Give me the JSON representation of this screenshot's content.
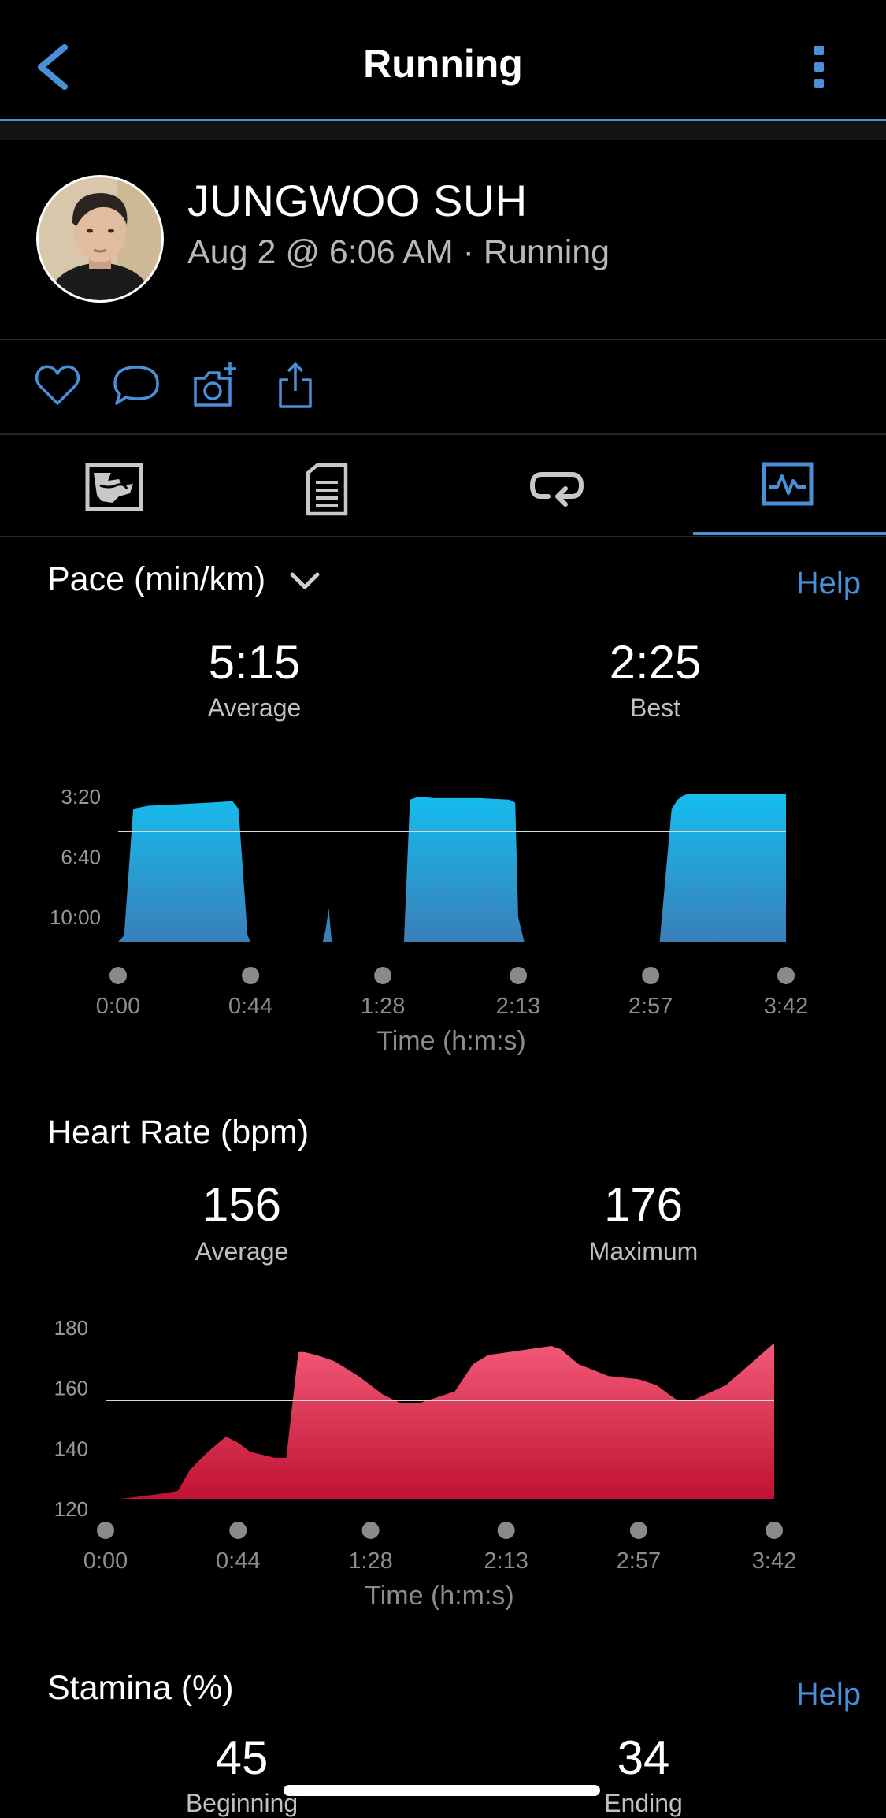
{
  "nav": {
    "title": "Running",
    "back_icon": "chevron-left-icon",
    "more_icon": "more-vertical-icon",
    "accent": "#4a90d9"
  },
  "profile": {
    "name": "JUNGWOO SUH",
    "meta": "Aug 2 @ 6:06 AM · Running"
  },
  "actions": [
    "heart-icon",
    "comment-icon",
    "add-photo-icon",
    "share-icon"
  ],
  "tabs": [
    "map-icon",
    "details-icon",
    "laps-icon",
    "charts-icon"
  ],
  "active_tab": "charts-icon",
  "pace": {
    "title": "Pace (min/km)",
    "help": "Help",
    "avg_value": "5:15",
    "avg_label": "Average",
    "best_value": "2:25",
    "best_label": "Best"
  },
  "heart": {
    "title": "Heart Rate (bpm)",
    "avg_value": "156",
    "avg_label": "Average",
    "max_value": "176",
    "max_label": "Maximum"
  },
  "stamina": {
    "title": "Stamina (%)",
    "help": "Help",
    "begin_value": "45",
    "begin_label": "Beginning",
    "end_value": "34",
    "end_label": "Ending"
  },
  "chart_data": [
    {
      "type": "area",
      "title": "Pace (min/km)",
      "xlabel": "Time (h:m:s)",
      "x_ticks": [
        "0:00",
        "0:44",
        "1:28",
        "2:13",
        "2:57",
        "3:42"
      ],
      "y_ticks": [
        "3:20",
        "6:40",
        "10:00"
      ],
      "y_axis_reversed": true,
      "reference_line": "5:15",
      "color": "#1cb8ea",
      "x": [
        "0:00",
        "0:02",
        "0:05",
        "0:10",
        "0:20",
        "0:30",
        "0:38",
        "0:40",
        "0:43",
        "0:44",
        "1:00",
        "1:08",
        "1:09",
        "1:10",
        "1:11",
        "1:28",
        "1:35",
        "1:37",
        "1:40",
        "1:45",
        "2:00",
        "2:10",
        "2:12",
        "2:13",
        "2:15",
        "2:30",
        "2:57",
        "3:00",
        "3:04",
        "3:06",
        "3:08",
        "3:10",
        "3:15",
        "3:30",
        "3:42"
      ],
      "y": [
        "11:40",
        "11:00",
        "4:00",
        "3:50",
        "3:45",
        "3:40",
        "3:35",
        "4:00",
        "11:00",
        "12:00",
        "12:00",
        "12:00",
        "10:40",
        "9:30",
        "12:00",
        "12:00",
        "12:00",
        "3:30",
        "3:20",
        "3:25",
        "3:25",
        "3:30",
        "3:40",
        "10:00",
        "12:00",
        "12:00",
        "12:00",
        "12:00",
        "4:00",
        "3:30",
        "3:15",
        "3:10",
        "3:10",
        "3:10",
        "3:10"
      ]
    },
    {
      "type": "area",
      "title": "Heart Rate (bpm)",
      "xlabel": "Time (h:m:s)",
      "x_ticks": [
        "0:00",
        "0:44",
        "1:28",
        "2:13",
        "2:57",
        "3:42"
      ],
      "y_ticks": [
        180,
        160,
        140,
        120
      ],
      "ylim": [
        120,
        180
      ],
      "reference_line": 156,
      "color": "#e0294e",
      "x": [
        "0:00",
        "0:05",
        "0:10",
        "0:18",
        "0:24",
        "0:28",
        "0:34",
        "0:40",
        "0:44",
        "0:48",
        "0:56",
        "1:00",
        "1:04",
        "1:06",
        "1:10",
        "1:16",
        "1:24",
        "1:32",
        "1:38",
        "1:44",
        "1:50",
        "1:56",
        "2:02",
        "2:07",
        "2:14",
        "2:28",
        "2:31",
        "2:37",
        "2:47",
        "2:57",
        "3:03",
        "3:07",
        "3:10",
        "3:15",
        "3:26",
        "3:34",
        "3:42"
      ],
      "y": [
        121,
        123,
        124,
        125,
        126,
        133,
        139,
        144,
        142,
        139,
        137,
        137,
        172,
        172,
        171,
        169,
        164,
        158,
        155,
        155,
        157,
        159,
        168,
        171,
        172,
        174,
        173,
        168,
        164,
        163,
        161,
        158,
        156,
        156,
        161,
        168,
        175
      ]
    }
  ]
}
